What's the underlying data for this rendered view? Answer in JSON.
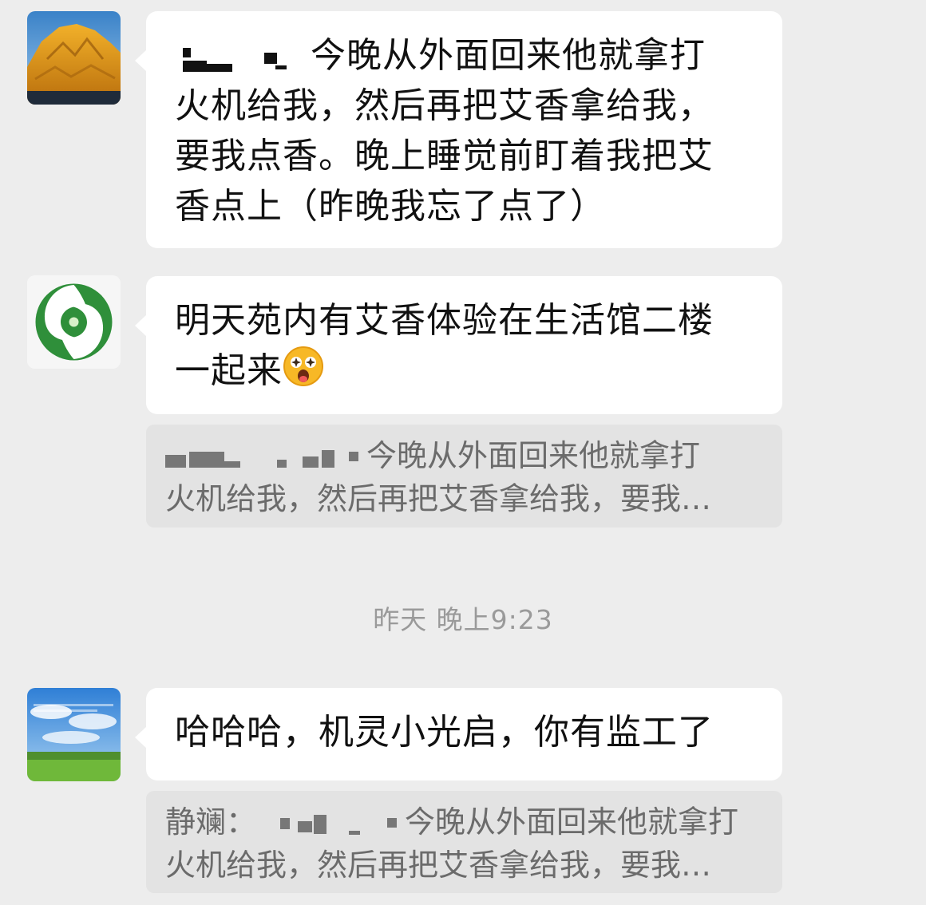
{
  "messages": [
    {
      "text_lines": [
        "今晚从外面回来他就拿打",
        "火机给我，然后再把艾香拿给我，",
        "要我点香。晚上睡觉前盯着我把艾",
        "香点上（昨晚我忘了点了）"
      ]
    },
    {
      "text_lines": [
        "明天苑内有艾香体验在生活馆二楼",
        "一起来"
      ],
      "emoji": "star-struck-emoji",
      "quote_lines": [
        "今晚从外面回来他就拿打",
        "火机给我，然后再把艾香拿给我，要我…"
      ]
    },
    {
      "text_lines": [
        "哈哈哈，机灵小光启，你有监工了"
      ],
      "quote_sender": "静斓：",
      "quote_lines": [
        "今晚从外面回来他就拿打",
        "火机给我，然后再把艾香拿给我，要我…"
      ]
    }
  ],
  "timestamp": "昨天 晚上9:23",
  "colors": {
    "background": "#ededed",
    "bubble": "#ffffff",
    "quote_bg": "#e3e3e3",
    "text": "#111111",
    "quote_text": "#6b6b6b",
    "timestamp": "#9a9a9a"
  },
  "icons": {
    "avatar_1": "mountain-sunset-avatar",
    "avatar_2": "green-swirl-logo-avatar",
    "avatar_3": "sky-grassland-avatar"
  }
}
